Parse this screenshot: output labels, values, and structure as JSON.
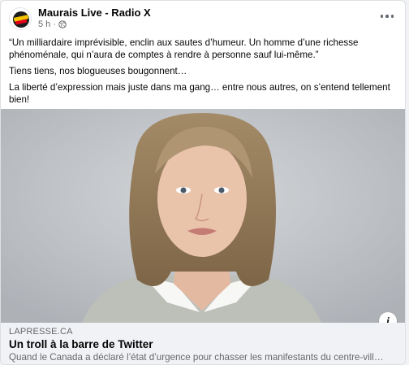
{
  "post": {
    "page_name": "Maurais Live - Radio X",
    "time": "5 h",
    "separator": "·",
    "avatar_text": "MAURAIS RADIO X",
    "paragraphs": [
      "“Un milliardaire imprévisible, enclin aux sautes d’humeur. Un homme d’une richesse phénoménale, qui n’aura de comptes à rendre à personne sauf lui-même.”",
      "Tiens tiens, nos blogueuses bougonnent…",
      "La liberté d’expression mais juste dans ma gang… entre nous autres, on s’entend tellement bien!"
    ]
  },
  "link": {
    "domain": "LAPRESSE.CA",
    "title": "Un troll à la barre de Twitter",
    "description": "Quand le Canada a déclaré l’état d’urgence pour chasser les manifestants du centre-vill…"
  },
  "icons": {
    "globe": "globe-icon",
    "more": "more-options-icon",
    "info": "info-icon"
  },
  "info_glyph": "i",
  "colors": {
    "text": "#050505",
    "secondary": "#65676b",
    "link_bg": "#f0f2f5",
    "image_bg": "#c2c5c9"
  }
}
